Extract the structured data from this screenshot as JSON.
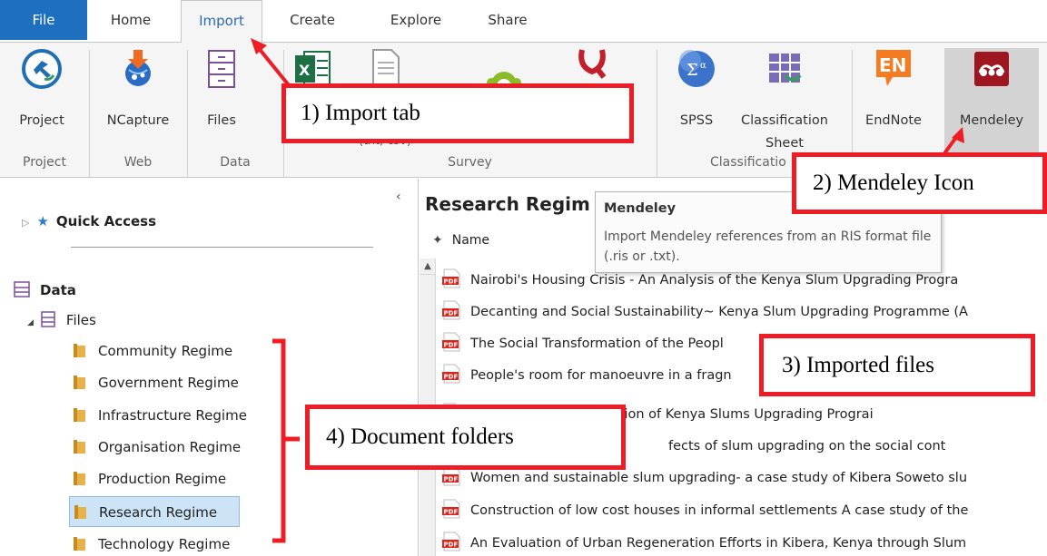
{
  "tabs": [
    {
      "label": "File"
    },
    {
      "label": "Home"
    },
    {
      "label": "Import"
    },
    {
      "label": "Create"
    },
    {
      "label": "Explore"
    },
    {
      "label": "Share"
    }
  ],
  "ribbon": {
    "buttons": {
      "project": "Project",
      "ncapture": "NCapture",
      "files": "Files",
      "spss": "SPSS",
      "classification_sheet_line1": "Classification",
      "classification_sheet_line2": "Sheet",
      "endnote": "EndNote",
      "mendeley": "Mendeley",
      "partial_survey_suffix": "s",
      "partial_survey_sub": "(txt, csv)"
    },
    "groups": {
      "project": "Project",
      "web": "Web",
      "data": "Data",
      "survey": "Survey",
      "classification": "Classificatio"
    }
  },
  "left_panel": {
    "quick_access": "Quick Access",
    "data_label": "Data",
    "files_label": "Files",
    "folders": [
      "Community Regime",
      "Government Regime",
      "Infrastructure Regime",
      "Organisation Regime",
      "Production Regime",
      "Research Regime",
      "Technology Regime"
    ],
    "selected_folder": "Research Regime"
  },
  "right_panel": {
    "title": "Research Regim",
    "column_name": "Name",
    "files": [
      "Nairobi's Housing Crisis - An Analysis of the Kenya Slum Upgrading Progra",
      "Decanting and Social Sustainability~ Kenya Slum Upgrading Programme (A",
      "The Social Transformation of the Peopl",
      "People's room for manoeuvre in a fragn",
      "ntation of Kenya Slums Upgrading Prograi",
      "fects of slum upgrading on the social cont",
      "Women and sustainable slum upgrading- a case study of Kibera Soweto slu",
      "Construction of low cost houses in informal settlements A case study of the",
      "An Evaluation of Urban Regeneration Efforts in Kibera, Kenya through Slum"
    ]
  },
  "tooltip": {
    "title": "Mendeley",
    "description": "Import Mendeley references from an RIS format file (.ris or .txt)."
  },
  "callouts": {
    "c1": "1) Import tab",
    "c2": "2) Mendeley Icon",
    "c3": "3) Imported files",
    "c4": "4) Document folders"
  },
  "colors": {
    "file_tab": "#1e6fbf",
    "callout_red": "#ee1c25",
    "mendeley_red": "#9d1620",
    "endnote_orange": "#f47b20",
    "pdf_red": "#d7261e",
    "folder_tan": "#e8b24a",
    "selection": "#cde4f7"
  }
}
